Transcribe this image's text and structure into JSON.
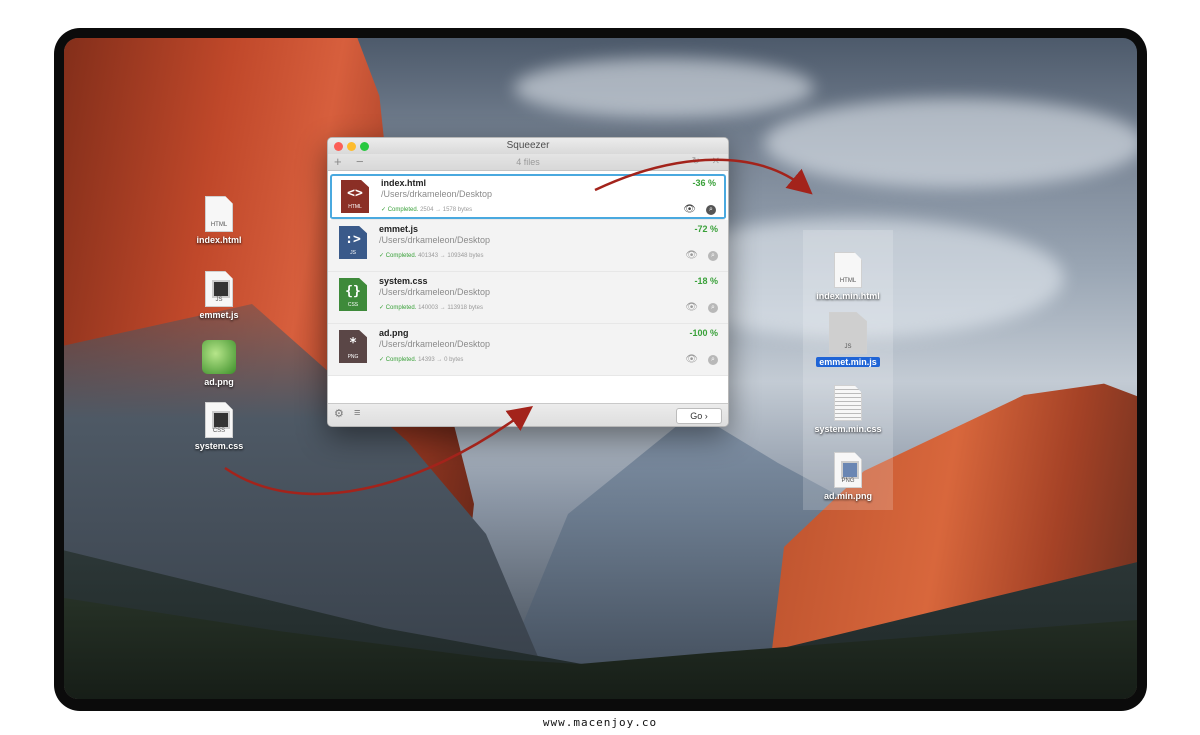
{
  "desktop_left_icons": [
    {
      "label": "index.html",
      "ext": "HTML",
      "kind": "doc"
    },
    {
      "label": "emmet.js",
      "ext": "JS",
      "kind": "doc-dark"
    },
    {
      "label": "ad.png",
      "ext": "",
      "kind": "leaf"
    },
    {
      "label": "system.css",
      "ext": "CSS",
      "kind": "doc-dark"
    }
  ],
  "desktop_right_icons": [
    {
      "label": "index.min.html",
      "ext": "HTML"
    },
    {
      "label": "emmet.min.js",
      "ext": "JS",
      "selected": true
    },
    {
      "label": "system.min.css",
      "ext": ""
    },
    {
      "label": "ad.min.png",
      "ext": "PNG"
    }
  ],
  "window": {
    "title": "Squeezer",
    "file_count": "4 files",
    "toolbar": {
      "add_icon": "plus-icon",
      "remove_icon": "minus-icon",
      "refresh_icon": "refresh-icon",
      "clear_icon": "close-icon"
    },
    "files": [
      {
        "name": "index.html",
        "path": "/Users/drkameleon/Desktop",
        "status": "Completed.",
        "sizes": "2504 → 1578 bytes",
        "percent": "-36 %",
        "symbol": "<>",
        "ext": "HTML",
        "color": "#8b2f26",
        "selected": true
      },
      {
        "name": "emmet.js",
        "path": "/Users/drkameleon/Desktop",
        "status": "Completed.",
        "sizes": "401343 → 109348 bytes",
        "percent": "-72 %",
        "symbol": ":>",
        "ext": "JS",
        "color": "#3a5a8a",
        "selected": false
      },
      {
        "name": "system.css",
        "path": "/Users/drkameleon/Desktop",
        "status": "Completed.",
        "sizes": "140003 → 113918 bytes",
        "percent": "-18 %",
        "symbol": "{}",
        "ext": "CSS",
        "color": "#3e8a3a",
        "selected": false
      },
      {
        "name": "ad.png",
        "path": "/Users/drkameleon/Desktop",
        "status": "Completed.",
        "sizes": "14393 → 0 bytes",
        "percent": "-100 %",
        "symbol": "*",
        "ext": "PNG",
        "color": "#5a4646",
        "selected": false
      }
    ],
    "footer": {
      "settings_icon": "gear-icon",
      "list_icon": "list-icon",
      "go_label": "Go"
    }
  },
  "colors": {
    "accent": "#4aa9df",
    "success": "#3aa13a",
    "arrow": "#a3231b"
  },
  "watermark": "www.macenjoy.co"
}
